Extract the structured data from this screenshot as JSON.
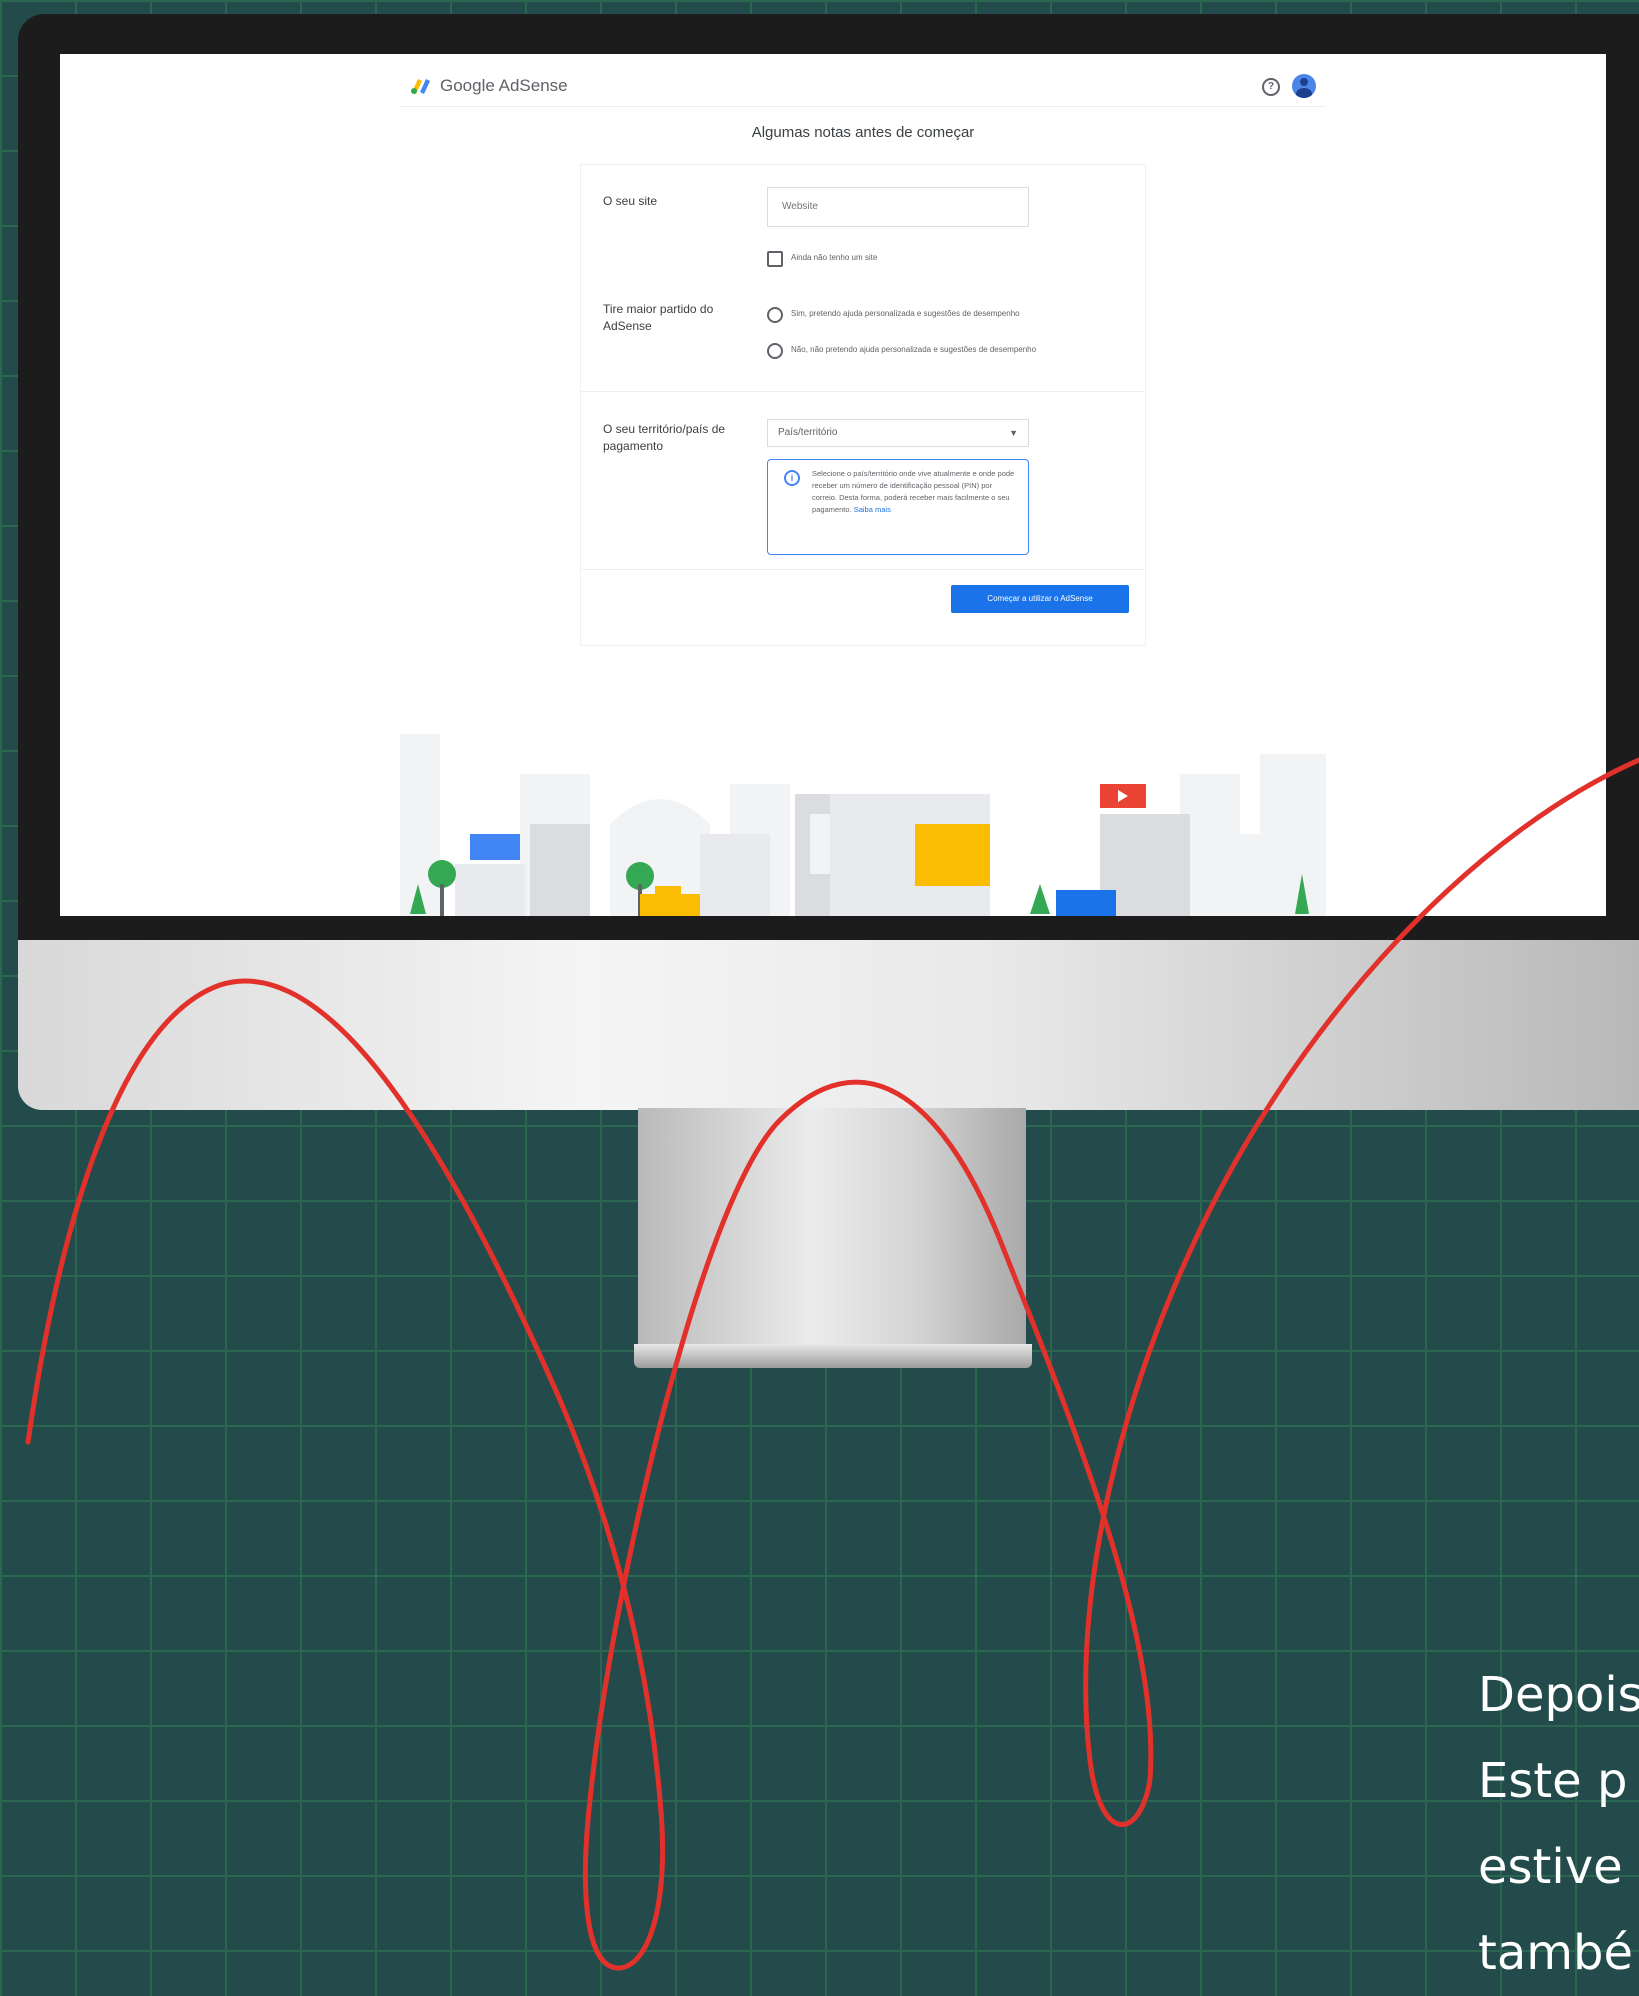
{
  "app": {
    "brand_google": "Google",
    "brand_product": "AdSense",
    "help_icon": "help-circle-icon",
    "avatar_icon": "user-avatar-icon",
    "page_title": "Algumas notas antes de começar"
  },
  "form": {
    "site_label": "O seu site",
    "site_placeholder": "Website",
    "no_site_checkbox": "Ainda não tenho um site",
    "maximize_label": "Tire maior partido do AdSense",
    "radio_yes": "Sim, pretendo ajuda personalizada e sugestões de desempenho",
    "radio_no": "Não, não pretendo ajuda personalizada e sugestões de desempenho",
    "country_label": "O seu território/país de pagamento",
    "country_select": "País/território",
    "info_text": "Selecione o país/território onde vive atualmente e onde pode receber um número de identificação pessoal (PIN) por correio. Desta forma, poderá receber mais facilmente o seu pagamento.",
    "info_link": "Saiba mais",
    "submit_button": "Começar a utilizar o AdSense"
  },
  "caption": {
    "lines": [
      "Depois",
      "Este p",
      "estive",
      "també"
    ]
  },
  "colors": {
    "background": "#234b4b",
    "grid": "#2b6650",
    "primary_blue": "#1a73e8",
    "curve_red": "#e2312b"
  }
}
